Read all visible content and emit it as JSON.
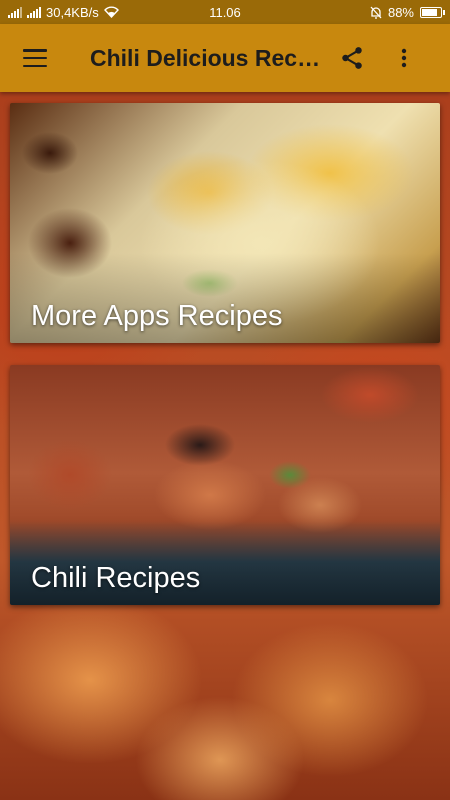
{
  "status_bar": {
    "network_speed": "30,4KB/s",
    "time": "11.06",
    "battery": "88%",
    "battery_level": 0.88
  },
  "app_bar": {
    "title": "Chili Delicious Recipes",
    "menu_icon": "hamburger-menu-icon",
    "share_icon": "share-icon",
    "overflow_icon": "more-vert-icon",
    "background_color": "#c8880e"
  },
  "cards": [
    {
      "label": "More Apps Recipes"
    },
    {
      "label": "Chili Recipes"
    }
  ],
  "colors": {
    "status_bar": "#9a6a08",
    "app_bar": "#c8880e",
    "card_text": "#ffffff"
  }
}
